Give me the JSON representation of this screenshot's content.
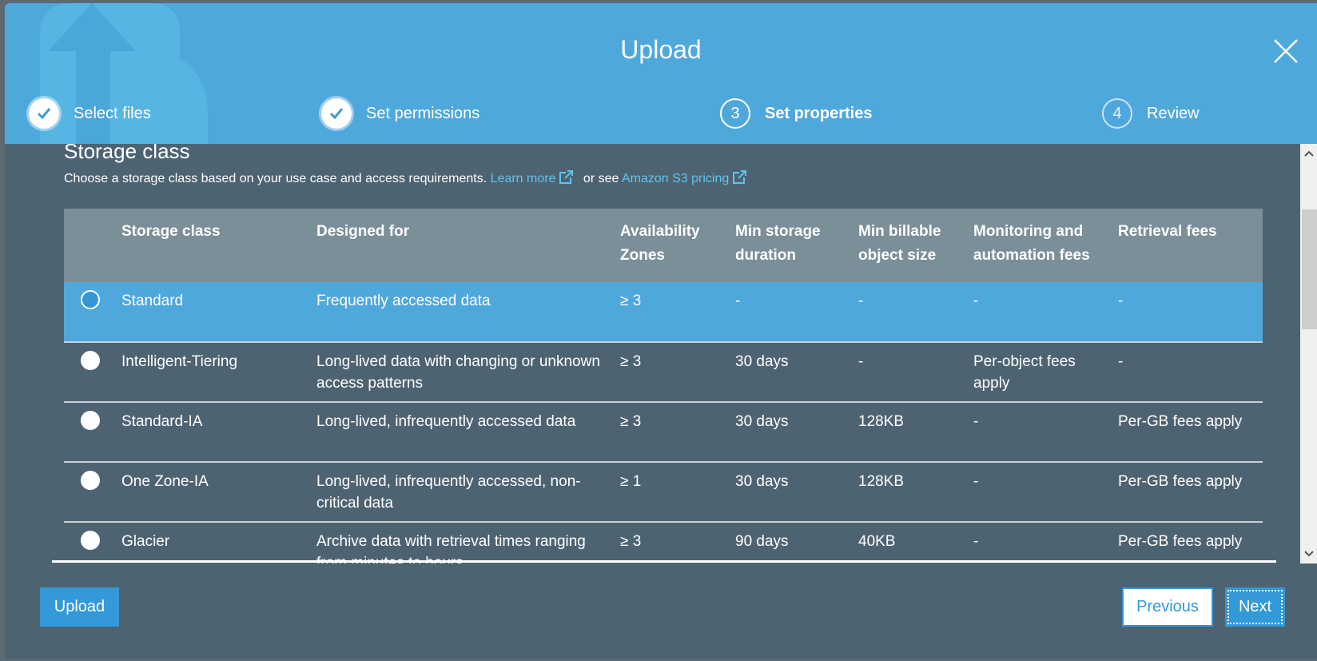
{
  "modal": {
    "title": "Upload",
    "close_label": "Close"
  },
  "steps": [
    {
      "number": "1",
      "label": "Select files",
      "state": "completed"
    },
    {
      "number": "2",
      "label": "Set permissions",
      "state": "completed"
    },
    {
      "number": "3",
      "label": "Set properties",
      "state": "active"
    },
    {
      "number": "4",
      "label": "Review",
      "state": "pending"
    }
  ],
  "section": {
    "title": "Storage class",
    "description": "Choose a storage class based on your use case and access requirements.",
    "learn_more": "Learn more",
    "or_see": "or see",
    "pricing_link": "Amazon S3 pricing"
  },
  "table": {
    "headers": {
      "storage_class": "Storage class",
      "designed_for": "Designed for",
      "availability_zones": "Availability Zones",
      "min_storage_duration": "Min storage duration",
      "min_billable_size": "Min billable object size",
      "monitoring_fees": "Monitoring and automation fees",
      "retrieval_fees": "Retrieval fees"
    },
    "rows": [
      {
        "storage_class": "Standard",
        "designed_for": "Frequently accessed data",
        "availability_zones": "≥ 3",
        "min_storage_duration": "-",
        "min_billable_size": "-",
        "monitoring_fees": "-",
        "retrieval_fees": "-",
        "selected": true
      },
      {
        "storage_class": "Intelligent-Tiering",
        "designed_for": "Long-lived data with changing or unknown access patterns",
        "availability_zones": "≥ 3",
        "min_storage_duration": "30 days",
        "min_billable_size": "-",
        "monitoring_fees": "Per-object fees apply",
        "retrieval_fees": "-",
        "selected": false
      },
      {
        "storage_class": "Standard-IA",
        "designed_for": "Long-lived, infrequently accessed data",
        "availability_zones": "≥ 3",
        "min_storage_duration": "30 days",
        "min_billable_size": "128KB",
        "monitoring_fees": "-",
        "retrieval_fees": "Per-GB fees apply",
        "selected": false
      },
      {
        "storage_class": "One Zone-IA",
        "designed_for": "Long-lived, infrequently accessed, non-critical data",
        "availability_zones": "≥ 1",
        "min_storage_duration": "30 days",
        "min_billable_size": "128KB",
        "monitoring_fees": "-",
        "retrieval_fees": "Per-GB fees apply",
        "selected": false
      },
      {
        "storage_class": "Glacier",
        "designed_for": "Archive data with retrieval times ranging from minutes to hours",
        "availability_zones": "≥ 3",
        "min_storage_duration": "90 days",
        "min_billable_size": "40KB",
        "monitoring_fees": "-",
        "retrieval_fees": "Per-GB fees apply",
        "selected": false
      }
    ]
  },
  "footer": {
    "upload_label": "Upload",
    "previous_label": "Previous",
    "next_label": "Next"
  },
  "colors": {
    "header_bg": "#4fa8dc",
    "body_bg": "#4e6372",
    "table_header_bg": "#7b8f99",
    "selected_row_bg": "#4fa8dc",
    "button_primary": "#3399d9",
    "link": "#5fc4ee"
  }
}
